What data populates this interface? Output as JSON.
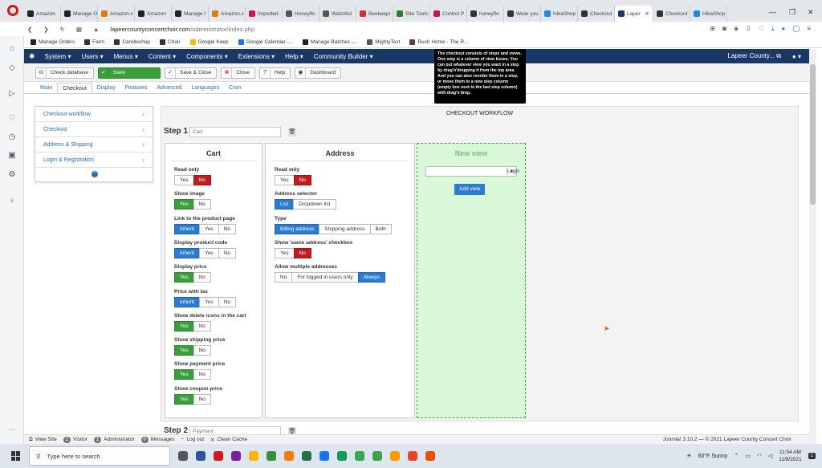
{
  "browser": {
    "tabs": [
      {
        "label": "Amazon",
        "color": "#222"
      },
      {
        "label": "Manage O",
        "color": "#222"
      },
      {
        "label": "Amazon.c",
        "color": "#e47911"
      },
      {
        "label": "Amazon",
        "color": "#222"
      },
      {
        "label": "Manage I",
        "color": "#222"
      },
      {
        "label": "Amazon.c",
        "color": "#e47911"
      },
      {
        "label": "Imported",
        "color": "#c2185b"
      },
      {
        "label": "Honeyflo",
        "color": "#555"
      },
      {
        "label": "Watchful",
        "color": "#555"
      },
      {
        "label": "Beekeepi",
        "color": "#d32f2f"
      },
      {
        "label": "Site Tools",
        "color": "#2e7d32"
      },
      {
        "label": "Control P",
        "color": "#c2185b"
      },
      {
        "label": "honeyflo",
        "color": "#333"
      },
      {
        "label": "Wear you",
        "color": "#333"
      },
      {
        "label": "HikaShop",
        "color": "#1e88e5"
      },
      {
        "label": "Checkout",
        "color": "#333"
      },
      {
        "label": "Laper",
        "color": "#1a3867",
        "active": true
      },
      {
        "label": "Checkout",
        "color": "#333"
      },
      {
        "label": "HikaShop",
        "color": "#1e88e5"
      }
    ],
    "url_prefix": "lapeercountyconcertchoir.com",
    "url_path": "/administrator/index.php",
    "bookmarks": [
      {
        "label": "Manage Orders",
        "color": "#222"
      },
      {
        "label": "Farm",
        "color": "#333"
      },
      {
        "label": "Candleshop",
        "color": "#333"
      },
      {
        "label": "Choir",
        "color": "#333"
      },
      {
        "label": "Google Keep",
        "color": "#fbbc04"
      },
      {
        "label": "Google Calendar -...",
        "color": "#1a73e8"
      },
      {
        "label": "Manage Batches -...",
        "color": "#222"
      },
      {
        "label": "MightyText",
        "color": "#555"
      },
      {
        "label": "Rush Home - The R...",
        "color": "#5d4037"
      }
    ]
  },
  "joomla": {
    "menu": [
      "System ▾",
      "Users ▾",
      "Menus ▾",
      "Content ▾",
      "Components ▾",
      "Extensions ▾",
      "Help ▾",
      "Community Builder ▾"
    ],
    "site_name": "Lapeer County...",
    "user_menu": "▾",
    "toolbar": {
      "check_database": "Check database",
      "save": "Save",
      "save_close": "Save & Close",
      "close": "Close",
      "help": "Help",
      "dashboard": "Dashboard"
    },
    "tabs": [
      "Main",
      "Checkout",
      "Display",
      "Features",
      "Advanced",
      "Languages",
      "Cron"
    ],
    "tooltip": "The checkout consists of steps and views. One step is a column of view boxes. You can put whatever view you want in a step by drag'n'dropping it from the top area. And you can also reorder them in a step, or move them to a new step column (empty box next to the last step column) with drag'n'drop.",
    "left_menu": [
      "Checkout workflow",
      "Checkout",
      "Address & Shipping",
      "Login & Registration"
    ],
    "workflow_title": "CHECKOUT WORKFLOW",
    "step1": {
      "label": "Step 1",
      "placeholder": "Cart"
    },
    "step2": {
      "label": "Step 2",
      "placeholder": "Payment"
    },
    "cart": {
      "title": "Cart",
      "options": [
        {
          "label": "Read only",
          "buttons": [
            "Yes",
            "No"
          ],
          "selected": 1,
          "style": "red"
        },
        {
          "label": "Show image",
          "buttons": [
            "Yes",
            "No"
          ],
          "selected": 0,
          "style": "green"
        },
        {
          "label": "Link to the product page",
          "buttons": [
            "Inherit",
            "Yes",
            "No"
          ],
          "selected": 0,
          "style": "blue"
        },
        {
          "label": "Display product code",
          "buttons": [
            "Inherit",
            "Yes",
            "No"
          ],
          "selected": 0,
          "style": "blue"
        },
        {
          "label": "Display price",
          "buttons": [
            "Yes",
            "No"
          ],
          "selected": 0,
          "style": "green"
        },
        {
          "label": "Price with tax",
          "buttons": [
            "Inherit",
            "Yes",
            "No"
          ],
          "selected": 0,
          "style": "blue"
        },
        {
          "label": "Show delete icons in the cart",
          "buttons": [
            "Yes",
            "No"
          ],
          "selected": 0,
          "style": "green"
        },
        {
          "label": "Show shipping price",
          "buttons": [
            "Yes",
            "No"
          ],
          "selected": 0,
          "style": "green"
        },
        {
          "label": "Show payment price",
          "buttons": [
            "Yes",
            "No"
          ],
          "selected": 0,
          "style": "green"
        },
        {
          "label": "Show coupon price",
          "buttons": [
            "Yes",
            "No"
          ],
          "selected": 0,
          "style": "green"
        }
      ]
    },
    "address": {
      "title": "Address",
      "options": [
        {
          "label": "Read only",
          "buttons": [
            "Yes",
            "No"
          ],
          "selected": 1,
          "style": "red"
        },
        {
          "label": "Address selector",
          "buttons": [
            "List",
            "Dropdown list"
          ],
          "selected": 0,
          "style": "blue"
        },
        {
          "label": "Type",
          "buttons": [
            "Billing address",
            "Shipping address",
            "Both"
          ],
          "selected": 0,
          "style": "blue"
        },
        {
          "label": "Show 'same address' checkbox",
          "buttons": [
            "Yes",
            "No"
          ],
          "selected": 1,
          "style": "red"
        },
        {
          "label": "Allow multiple addresses",
          "buttons": [
            "No",
            "For logged in users only",
            "Always"
          ],
          "selected": 2,
          "style": "blue"
        }
      ]
    },
    "new_view": {
      "title": "New view",
      "select_value": "Login",
      "add_label": "Add view"
    },
    "status": {
      "view_site": "View Site",
      "visitor_count": "1",
      "visitor": "Visitor",
      "admin_count": "1",
      "admin": "Administrator",
      "msg_count": "0",
      "messages": "Messages",
      "logout": "Log out",
      "clean_cache": "Clean Cache",
      "version": "Joomla! 3.10.2 — © 2021 Lapeer County Concert Choir"
    }
  },
  "taskbar": {
    "search_placeholder": "Type here to search",
    "weather": "60°F  Sunny",
    "time": "11:54 AM",
    "date": "11/8/2021",
    "notif_count": "1",
    "icons": [
      "#555",
      "#2b579a",
      "#d01a1a",
      "#7b1fa2",
      "#f4b400",
      "#388e3c",
      "#f57c00",
      "#217346",
      "#1a73e8",
      "#0f9d58",
      "#34a853",
      "#43a047",
      "#ff9800",
      "#ea4335",
      "#e65100"
    ]
  },
  "colors": {
    "nav": "#1a3867",
    "green": "#3c9d3c",
    "red": "#bd1e1e",
    "blue": "#2a7bd1"
  }
}
